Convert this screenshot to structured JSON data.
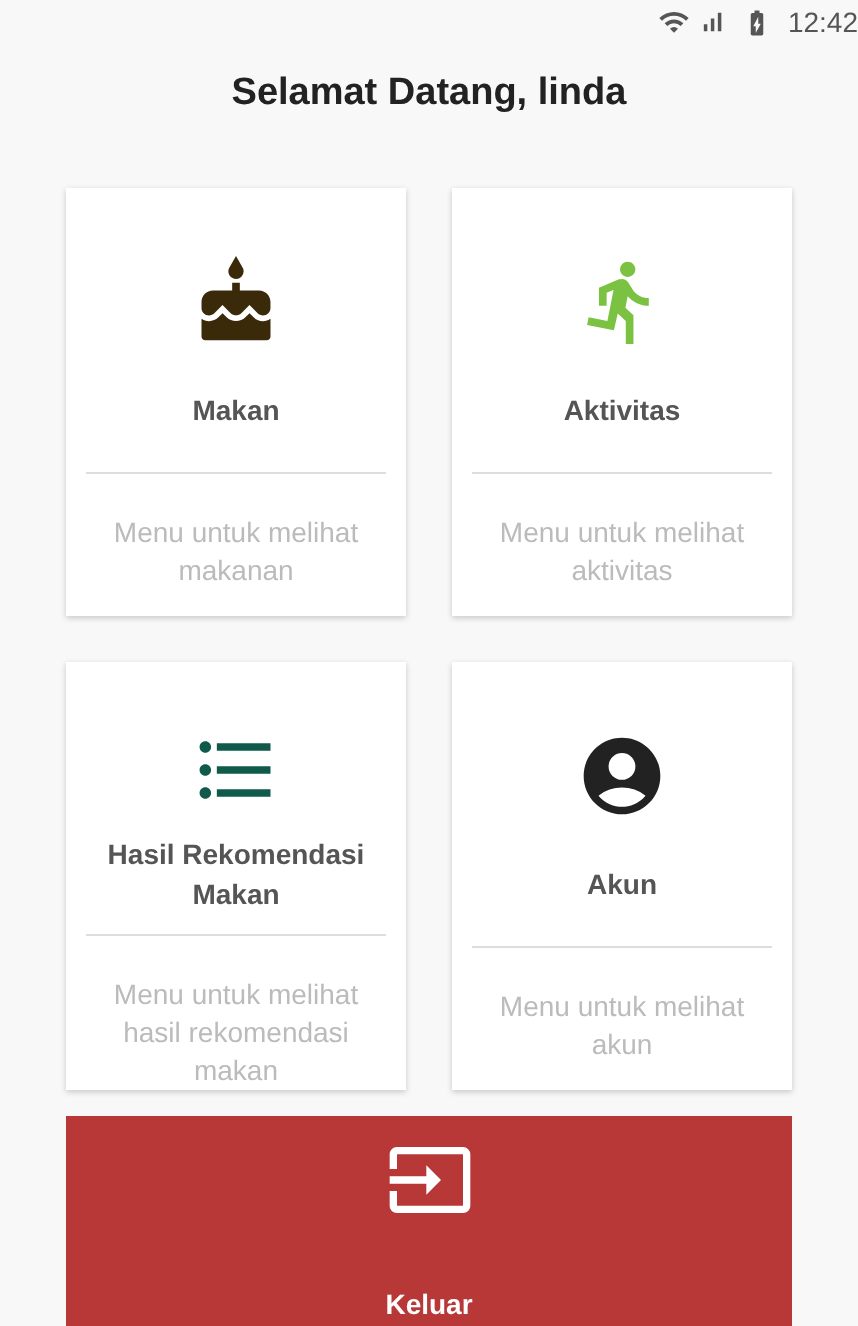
{
  "status_bar": {
    "time": "12:42"
  },
  "title": "Selamat Datang, linda",
  "menu": [
    {
      "kind": "cake",
      "color": "#3b2a0a",
      "label": "Makan",
      "description": "Menu untuk melihat makanan"
    },
    {
      "kind": "run",
      "color": "#7cc242",
      "label": "Aktivitas",
      "description": "Menu untuk melihat aktivitas"
    },
    {
      "kind": "list",
      "color": "#0f5a4a",
      "label": "Hasil Rekomendasi Makan",
      "description": "Menu untuk melihat hasil rekomendasi makan"
    },
    {
      "kind": "account",
      "color": "#222222",
      "label": "Akun",
      "description": "Menu untuk melihat akun"
    }
  ],
  "logout": {
    "label": "Keluar"
  }
}
